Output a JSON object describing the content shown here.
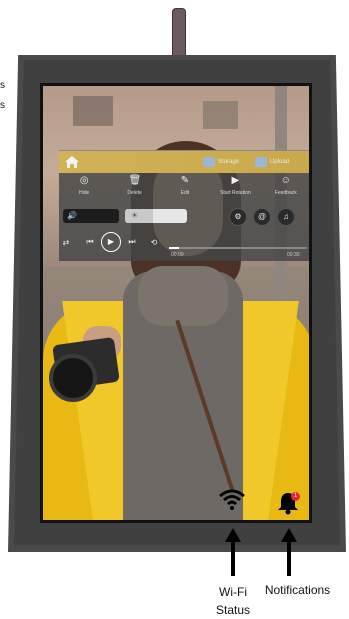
{
  "side_text": {
    "line1": "s",
    "line2": "s"
  },
  "panel": {
    "storage_label": "Storage",
    "upload_label": "Upload",
    "tools": [
      {
        "icon": "eye-off-icon",
        "label": "Hide"
      },
      {
        "icon": "trash-icon",
        "label": "Delete"
      },
      {
        "icon": "edit-icon",
        "label": "Edit"
      },
      {
        "icon": "play-circle-icon",
        "label": "Start Rotation"
      },
      {
        "icon": "smiley-icon",
        "label": "Feedback"
      }
    ],
    "time_start": "00:00",
    "time_end": "00:30"
  },
  "status": {
    "notification_count": "1"
  },
  "captions": {
    "wifi_line1": "Wi-Fi",
    "wifi_line2": "Status",
    "notifications": "Notifications"
  }
}
